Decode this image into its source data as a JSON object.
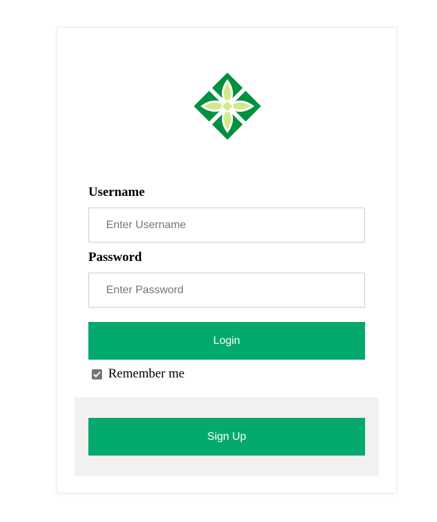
{
  "form": {
    "username_label": "Username",
    "username_placeholder": "Enter Username",
    "password_label": "Password",
    "password_placeholder": "Enter Password",
    "login_label": "Login",
    "remember_label": "Remember me",
    "remember_checked": true,
    "signup_label": "Sign Up"
  },
  "icons": {
    "logo": "green-quatrefoil-logo-icon",
    "checkbox": "checkmark-icon"
  },
  "colors": {
    "button": "#04aa6d",
    "logo_dark": "#00913e",
    "logo_light": "#d3e88a",
    "footer_bg": "#f1f1f1",
    "input_border": "#cccccc"
  }
}
